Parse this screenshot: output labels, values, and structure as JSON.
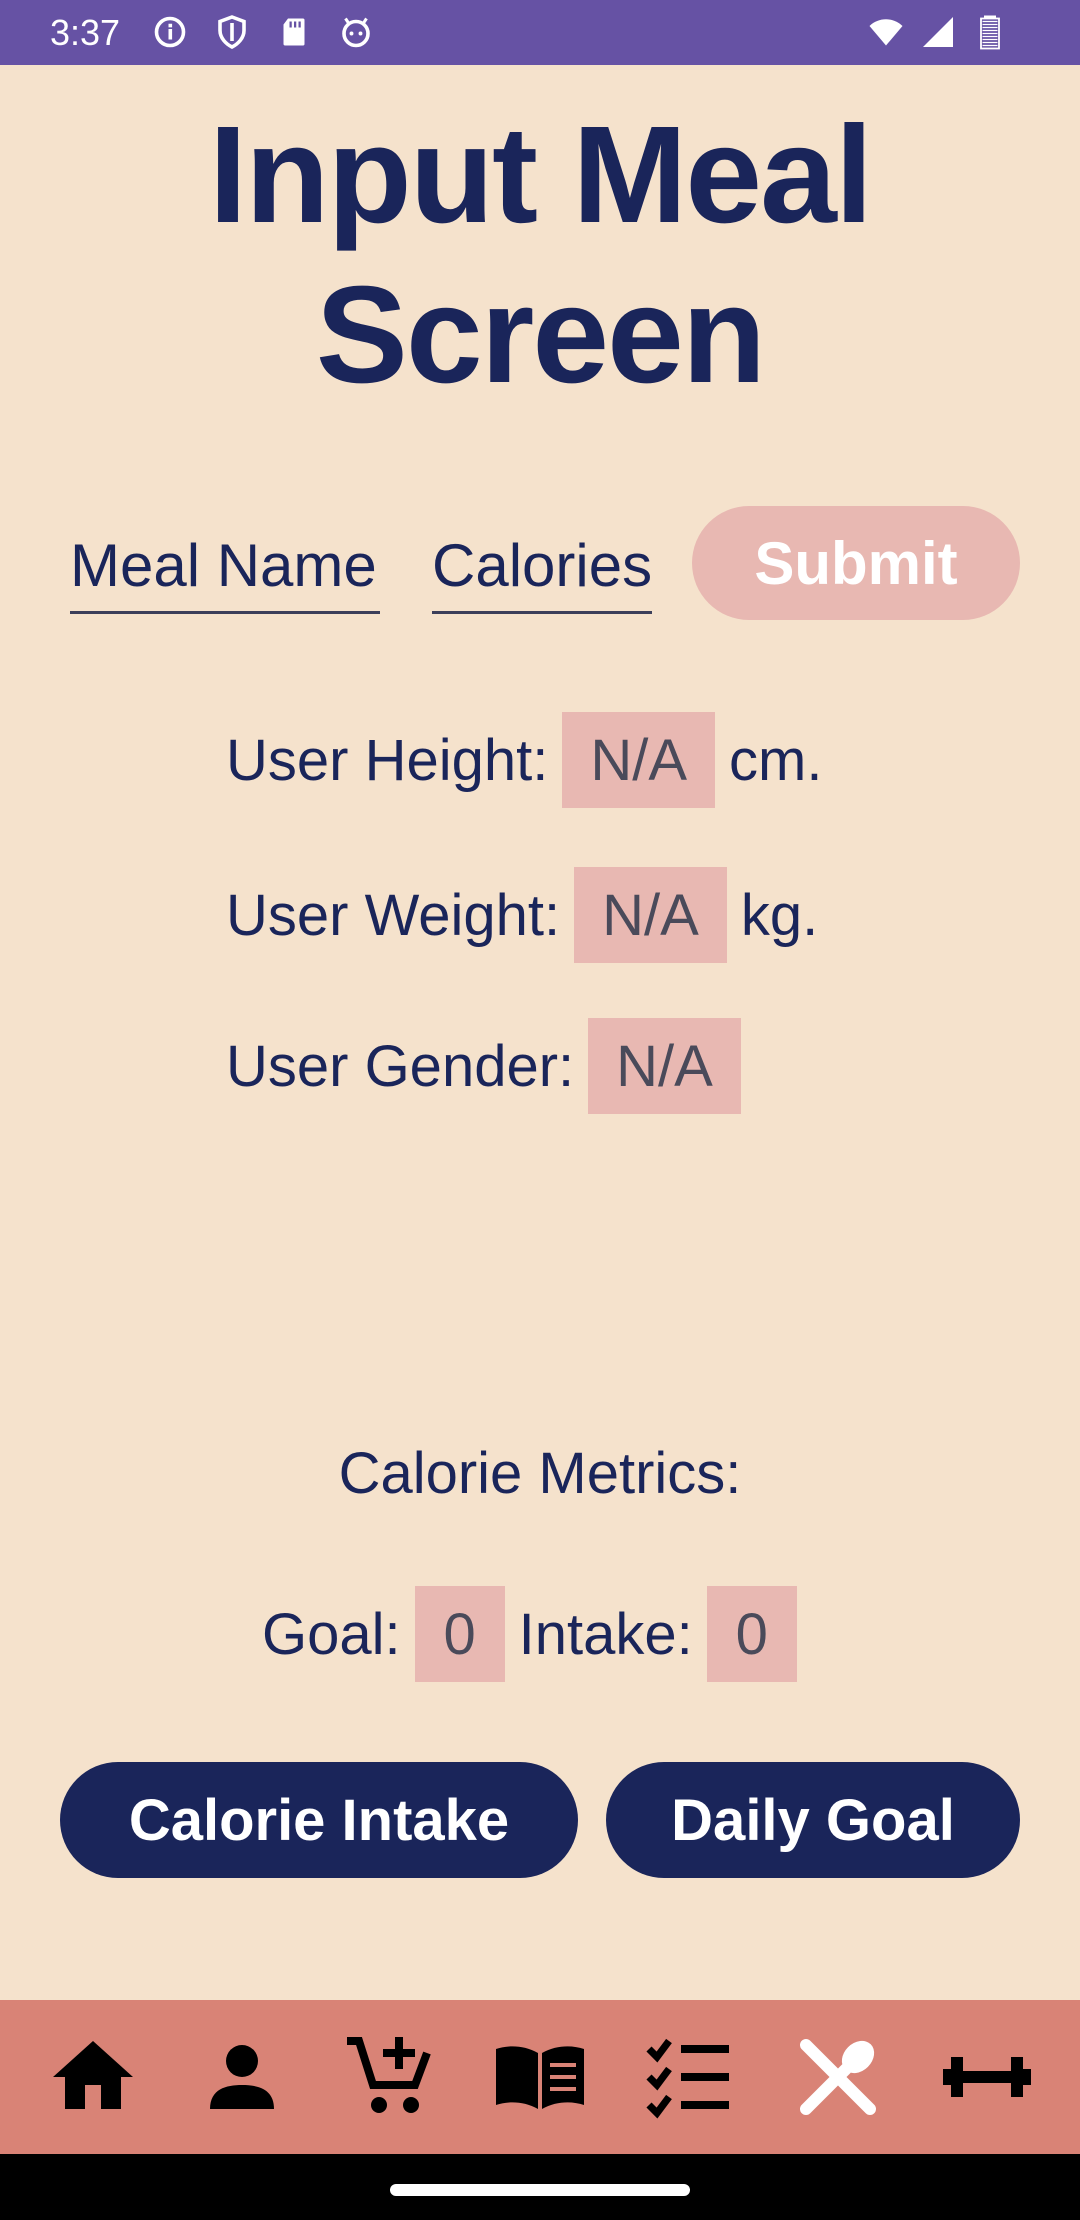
{
  "status_bar": {
    "time": "3:37",
    "left_icons": [
      "info-icon",
      "shield-icon",
      "sd-card-icon",
      "android-icon"
    ],
    "right_icons": [
      "wifi-icon",
      "signal-icon",
      "battery-icon"
    ],
    "background_color": "#6652a4"
  },
  "title": {
    "line1": "Input Meal",
    "line2": "Screen"
  },
  "form": {
    "meal_name_placeholder": "Meal Name",
    "calories_placeholder": "Calories",
    "submit_label": "Submit"
  },
  "user_info": {
    "height_label": "User Height:",
    "height_value": "N/A",
    "height_unit": "cm.",
    "weight_label": "User Weight:",
    "weight_value": "N/A",
    "weight_unit": "kg.",
    "gender_label": "User Gender:",
    "gender_value": "N/A"
  },
  "metrics": {
    "title": "Calorie Metrics:",
    "goal_label": "Goal:",
    "goal_value": "0",
    "intake_label": "Intake:",
    "intake_value": "0"
  },
  "actions": {
    "calorie_intake_label": "Calorie Intake",
    "daily_goal_label": "Daily Goal"
  },
  "bottom_nav": {
    "items": [
      "home-icon",
      "person-icon",
      "add-to-cart-icon",
      "book-icon",
      "checklist-icon",
      "dining-icon",
      "dumbbell-icon"
    ],
    "selected": "dining-icon"
  },
  "colors": {
    "background": "#f5e2cc",
    "primary": "#1a255a",
    "accent": "#e8b8b2",
    "nav": "#d98376"
  }
}
